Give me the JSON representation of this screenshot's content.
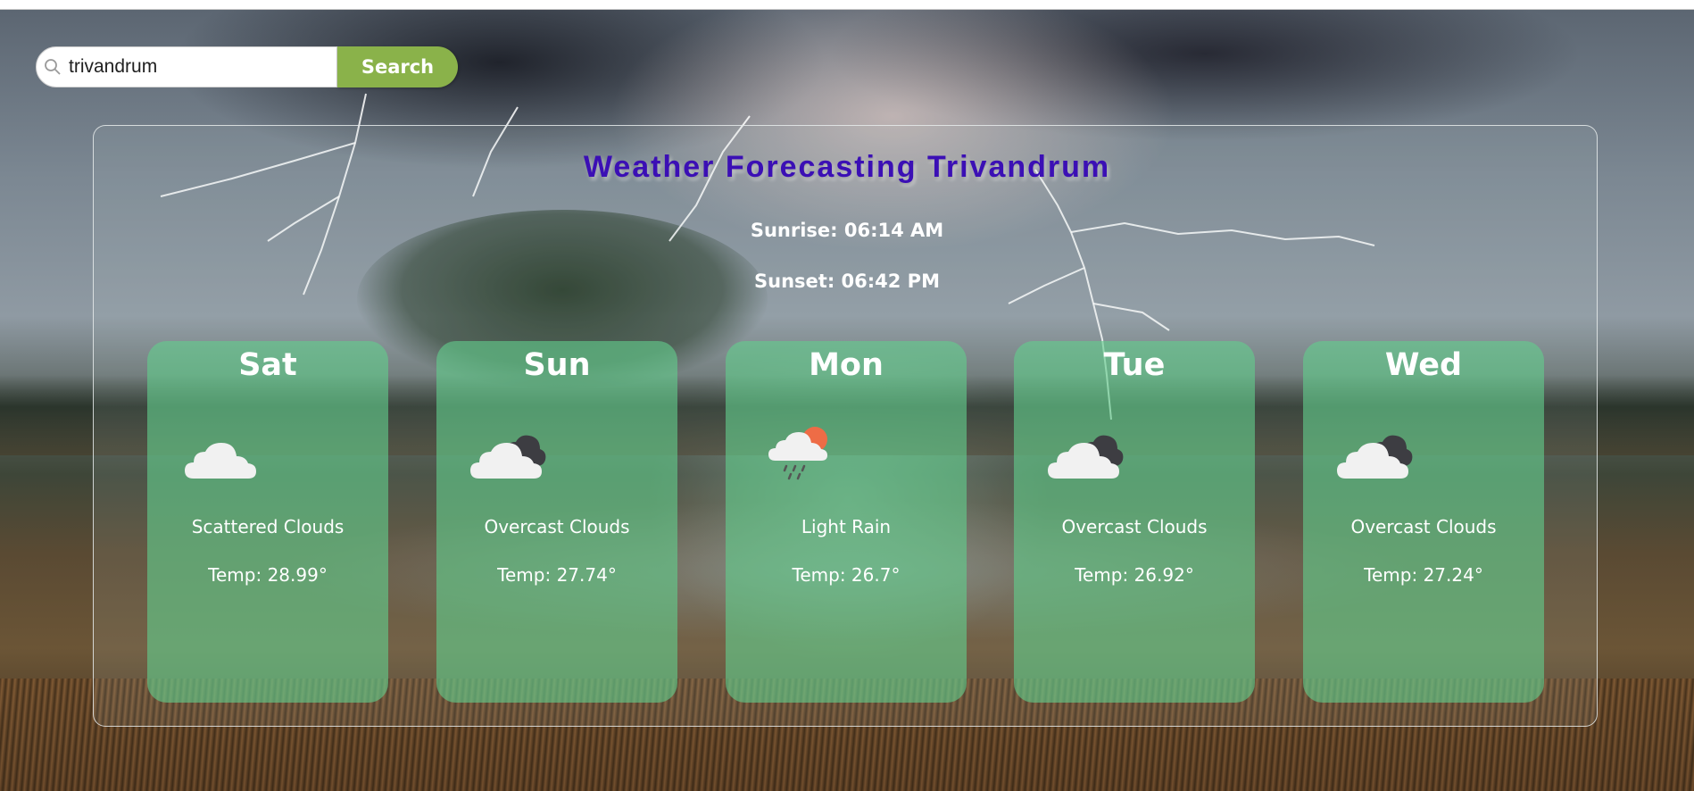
{
  "search": {
    "value": "trivandrum",
    "button_label": "Search"
  },
  "forecast": {
    "title": "Weather Forecasting Trivandrum",
    "sunrise": "Sunrise: 06:14 AM",
    "sunset": "Sunset: 06:42 PM",
    "days": [
      {
        "day": "Sat",
        "icon": "scattered-clouds-icon",
        "description": "Scattered Clouds",
        "temp": "Temp: 28.99°"
      },
      {
        "day": "Sun",
        "icon": "overcast-clouds-icon",
        "description": "Overcast Clouds",
        "temp": "Temp: 27.74°"
      },
      {
        "day": "Mon",
        "icon": "light-rain-icon",
        "description": "Light Rain",
        "temp": "Temp: 26.7°"
      },
      {
        "day": "Tue",
        "icon": "overcast-clouds-icon",
        "description": "Overcast Clouds",
        "temp": "Temp: 26.92°"
      },
      {
        "day": "Wed",
        "icon": "overcast-clouds-icon",
        "description": "Overcast Clouds",
        "temp": "Temp: 27.24°"
      }
    ]
  },
  "colors": {
    "title": "#3b0fb5",
    "search_button": "#8ab24a",
    "card": "#62cd8c"
  }
}
